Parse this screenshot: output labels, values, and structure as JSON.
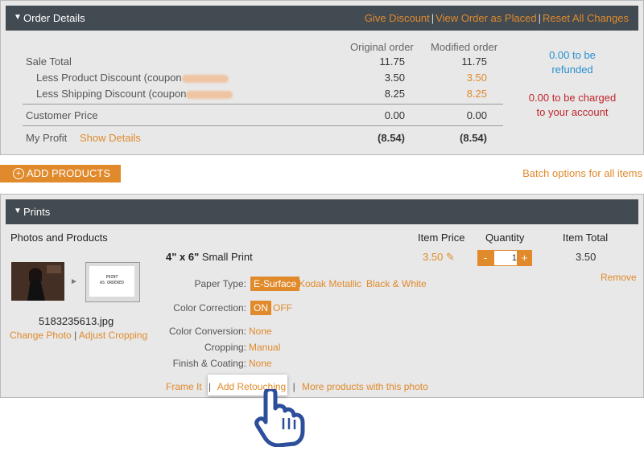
{
  "order_details": {
    "title": "Order Details",
    "links": [
      "Give Discount",
      "View Order as Placed",
      "Reset All Changes"
    ],
    "col_original": "Original order",
    "col_modified": "Modified order",
    "rows": [
      {
        "label": "Sale Total",
        "original": "11.75",
        "modified": "11.75"
      },
      {
        "label": "Less Product Discount (coupon",
        "original": "3.50",
        "modified": "3.50"
      },
      {
        "label": "Less Shipping Discount (coupon",
        "original": "8.25",
        "modified": "8.25"
      },
      {
        "label": "Customer Price",
        "original": "0.00",
        "modified": "0.00"
      },
      {
        "label": "My Profit",
        "original": "(8.54)",
        "modified": "(8.54)"
      }
    ],
    "show_details": "Show Details",
    "refund_line1": "0.00 to be",
    "refund_line2": "refunded",
    "charge_line1": "0.00 to be charged",
    "charge_line2": "to your account",
    "refund_color": "#2a8fd0",
    "charge_color": "#c0262c"
  },
  "actions": {
    "add_products": "ADD PRODUCTS",
    "batch_options": "Batch options for all items"
  },
  "prints": {
    "title": "Prints",
    "col_photos": "Photos and Products",
    "col_item_price": "Item Price",
    "col_quantity": "Quantity",
    "col_item_total": "Item Total",
    "product_size": "4\" x 6\"",
    "product_name": "Small Print",
    "price": "3.50",
    "quantity": "1",
    "qty_minus": "-",
    "qty_plus": "+",
    "item_total": "3.50",
    "remove": "Remove",
    "preview_text_1": "PRINT",
    "preview_text_2": "AS ORDERED",
    "filename": "5183235613.jpg",
    "change_photo": "Change Photo",
    "adjust_cropping": "Adjust Cropping",
    "paper_type_label": "Paper Type:",
    "paper_options": [
      "E-Surface",
      "Kodak Metallic",
      "Black & White"
    ],
    "color_correction_label": "Color Correction:",
    "color_correction_options": [
      "ON",
      "OFF"
    ],
    "color_conversion_label": "Color Conversion:",
    "color_conversion_value": "None",
    "cropping_label": "Cropping:",
    "cropping_value": "Manual",
    "finish_label": "Finish & Coating:",
    "finish_value": "None",
    "bottom_links": [
      "Frame It",
      "Add Retouching",
      "More products with this photo"
    ],
    "separator": "|"
  },
  "colors": {
    "accent": "#e08a2c",
    "header_bg": "#424a52",
    "panel_bg": "#e8e8e8",
    "cursor": "#2d4e9a"
  },
  "icons": {
    "collapse": "triangle-down-icon",
    "add": "plus-circle-icon",
    "edit": "pencil-icon",
    "arrow": "arrow-right-icon",
    "cursor": "hand-pointer-icon"
  }
}
